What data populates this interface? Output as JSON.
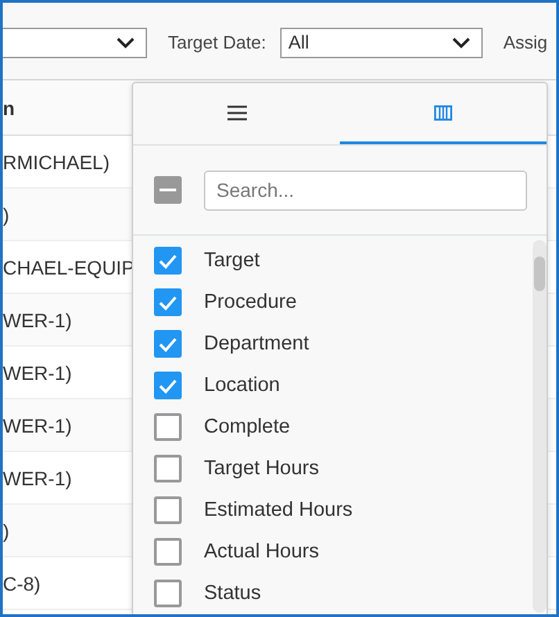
{
  "filters": [
    {
      "kind": "dropdown"
    },
    {
      "kind": "labeled",
      "label": "Target Date:",
      "value": "All"
    }
  ],
  "cut_label": "Assig",
  "table": {
    "header": "n",
    "rows": [
      "RMICHAEL)",
      ")",
      "CHAEL-EQUIP",
      "WER-1)",
      "WER-1)",
      "WER-1)",
      "WER-1)",
      ")",
      "C-8)"
    ]
  },
  "column_chooser": {
    "tabs": [
      {
        "kind": "menu",
        "selected": false
      },
      {
        "kind": "columns",
        "selected": true
      }
    ],
    "select_all": {
      "indeterminate": true
    },
    "search": {
      "placeholder": "Search..."
    },
    "columns": [
      {
        "label": "Target",
        "checked": true
      },
      {
        "label": "Procedure",
        "checked": true
      },
      {
        "label": "Department",
        "checked": true
      },
      {
        "label": "Location",
        "checked": true
      },
      {
        "label": "Complete",
        "checked": false
      },
      {
        "label": "Target Hours",
        "checked": false
      },
      {
        "label": "Estimated Hours",
        "checked": false
      },
      {
        "label": "Actual Hours",
        "checked": false
      },
      {
        "label": "Status",
        "checked": false
      }
    ]
  }
}
